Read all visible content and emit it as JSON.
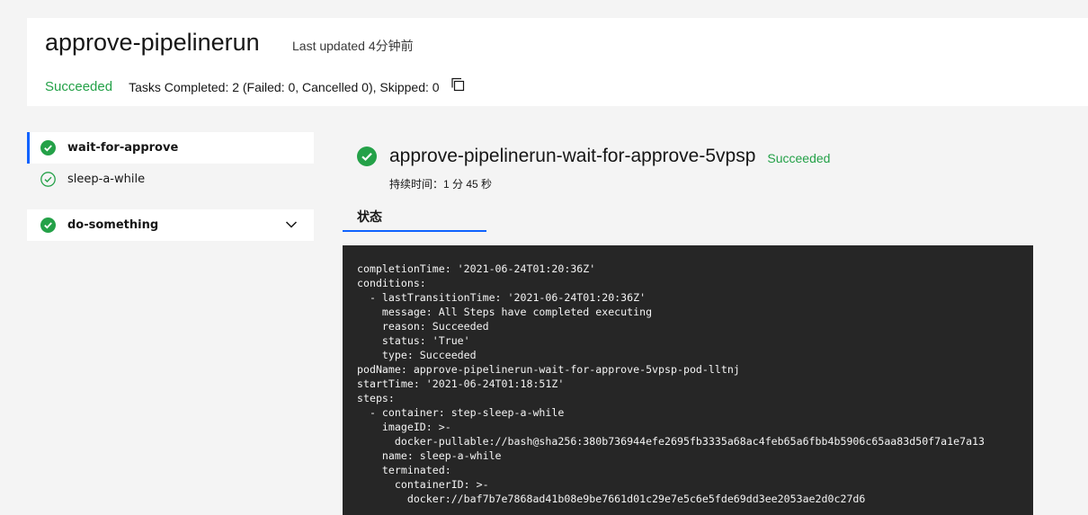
{
  "header": {
    "title": "approve-pipelinerun",
    "last_updated": "Last updated 4分钟前",
    "status": "Succeeded",
    "tasks_summary": "Tasks Completed: 2 (Failed: 0, Cancelled 0), Skipped: 0"
  },
  "sidebar": {
    "groups": [
      {
        "label": "wait-for-approve",
        "steps": [
          {
            "label": "sleep-a-while"
          }
        ]
      },
      {
        "label": "do-something"
      }
    ]
  },
  "main": {
    "run_title": "approve-pipelinerun-wait-for-approve-5vpsp",
    "run_status": "Succeeded",
    "duration": "持续时间：1 分 45 秒",
    "tab_label": "状态",
    "yaml": "completionTime: '2021-06-24T01:20:36Z'\nconditions:\n  - lastTransitionTime: '2021-06-24T01:20:36Z'\n    message: All Steps have completed executing\n    reason: Succeeded\n    status: 'True'\n    type: Succeeded\npodName: approve-pipelinerun-wait-for-approve-5vpsp-pod-lltnj\nstartTime: '2021-06-24T01:18:51Z'\nsteps:\n  - container: step-sleep-a-while\n    imageID: >-\n      docker-pullable://bash@sha256:380b736944efe2695fb3335a68ac4feb65a6fbb4b5906c65aa83d50f7a1e7a13\n    name: sleep-a-while\n    terminated:\n      containerID: >-\n        docker://baf7b7e7868ad41b08e9be7661d01c29e7e5c6e5fde69dd3ee2053ae2d0c27d6"
  },
  "colors": {
    "success": "#24a148",
    "accent": "#0f62fe",
    "code_bg": "#262626"
  },
  "icons": {
    "status": "check-circle-icon",
    "step": "check-circle-outline-icon",
    "copy": "copy-icon",
    "expand": "chevron-down-icon"
  }
}
